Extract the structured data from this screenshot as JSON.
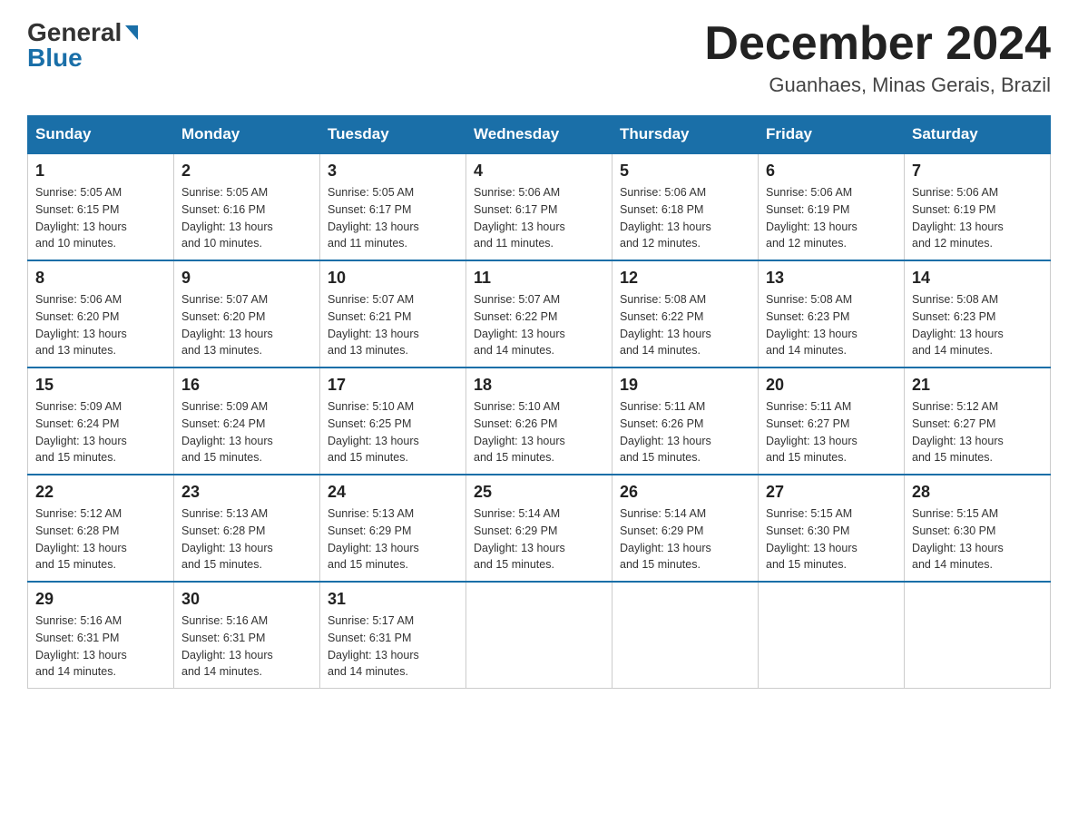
{
  "header": {
    "logo_general": "General",
    "logo_blue": "Blue",
    "month_title": "December 2024",
    "location": "Guanhaes, Minas Gerais, Brazil"
  },
  "days_of_week": [
    "Sunday",
    "Monday",
    "Tuesday",
    "Wednesday",
    "Thursday",
    "Friday",
    "Saturday"
  ],
  "weeks": [
    [
      {
        "day": "1",
        "sunrise": "5:05 AM",
        "sunset": "6:15 PM",
        "daylight": "13 hours and 10 minutes."
      },
      {
        "day": "2",
        "sunrise": "5:05 AM",
        "sunset": "6:16 PM",
        "daylight": "13 hours and 10 minutes."
      },
      {
        "day": "3",
        "sunrise": "5:05 AM",
        "sunset": "6:17 PM",
        "daylight": "13 hours and 11 minutes."
      },
      {
        "day": "4",
        "sunrise": "5:06 AM",
        "sunset": "6:17 PM",
        "daylight": "13 hours and 11 minutes."
      },
      {
        "day": "5",
        "sunrise": "5:06 AM",
        "sunset": "6:18 PM",
        "daylight": "13 hours and 12 minutes."
      },
      {
        "day": "6",
        "sunrise": "5:06 AM",
        "sunset": "6:19 PM",
        "daylight": "13 hours and 12 minutes."
      },
      {
        "day": "7",
        "sunrise": "5:06 AM",
        "sunset": "6:19 PM",
        "daylight": "13 hours and 12 minutes."
      }
    ],
    [
      {
        "day": "8",
        "sunrise": "5:06 AM",
        "sunset": "6:20 PM",
        "daylight": "13 hours and 13 minutes."
      },
      {
        "day": "9",
        "sunrise": "5:07 AM",
        "sunset": "6:20 PM",
        "daylight": "13 hours and 13 minutes."
      },
      {
        "day": "10",
        "sunrise": "5:07 AM",
        "sunset": "6:21 PM",
        "daylight": "13 hours and 13 minutes."
      },
      {
        "day": "11",
        "sunrise": "5:07 AM",
        "sunset": "6:22 PM",
        "daylight": "13 hours and 14 minutes."
      },
      {
        "day": "12",
        "sunrise": "5:08 AM",
        "sunset": "6:22 PM",
        "daylight": "13 hours and 14 minutes."
      },
      {
        "day": "13",
        "sunrise": "5:08 AM",
        "sunset": "6:23 PM",
        "daylight": "13 hours and 14 minutes."
      },
      {
        "day": "14",
        "sunrise": "5:08 AM",
        "sunset": "6:23 PM",
        "daylight": "13 hours and 14 minutes."
      }
    ],
    [
      {
        "day": "15",
        "sunrise": "5:09 AM",
        "sunset": "6:24 PM",
        "daylight": "13 hours and 15 minutes."
      },
      {
        "day": "16",
        "sunrise": "5:09 AM",
        "sunset": "6:24 PM",
        "daylight": "13 hours and 15 minutes."
      },
      {
        "day": "17",
        "sunrise": "5:10 AM",
        "sunset": "6:25 PM",
        "daylight": "13 hours and 15 minutes."
      },
      {
        "day": "18",
        "sunrise": "5:10 AM",
        "sunset": "6:26 PM",
        "daylight": "13 hours and 15 minutes."
      },
      {
        "day": "19",
        "sunrise": "5:11 AM",
        "sunset": "6:26 PM",
        "daylight": "13 hours and 15 minutes."
      },
      {
        "day": "20",
        "sunrise": "5:11 AM",
        "sunset": "6:27 PM",
        "daylight": "13 hours and 15 minutes."
      },
      {
        "day": "21",
        "sunrise": "5:12 AM",
        "sunset": "6:27 PM",
        "daylight": "13 hours and 15 minutes."
      }
    ],
    [
      {
        "day": "22",
        "sunrise": "5:12 AM",
        "sunset": "6:28 PM",
        "daylight": "13 hours and 15 minutes."
      },
      {
        "day": "23",
        "sunrise": "5:13 AM",
        "sunset": "6:28 PM",
        "daylight": "13 hours and 15 minutes."
      },
      {
        "day": "24",
        "sunrise": "5:13 AM",
        "sunset": "6:29 PM",
        "daylight": "13 hours and 15 minutes."
      },
      {
        "day": "25",
        "sunrise": "5:14 AM",
        "sunset": "6:29 PM",
        "daylight": "13 hours and 15 minutes."
      },
      {
        "day": "26",
        "sunrise": "5:14 AM",
        "sunset": "6:29 PM",
        "daylight": "13 hours and 15 minutes."
      },
      {
        "day": "27",
        "sunrise": "5:15 AM",
        "sunset": "6:30 PM",
        "daylight": "13 hours and 15 minutes."
      },
      {
        "day": "28",
        "sunrise": "5:15 AM",
        "sunset": "6:30 PM",
        "daylight": "13 hours and 14 minutes."
      }
    ],
    [
      {
        "day": "29",
        "sunrise": "5:16 AM",
        "sunset": "6:31 PM",
        "daylight": "13 hours and 14 minutes."
      },
      {
        "day": "30",
        "sunrise": "5:16 AM",
        "sunset": "6:31 PM",
        "daylight": "13 hours and 14 minutes."
      },
      {
        "day": "31",
        "sunrise": "5:17 AM",
        "sunset": "6:31 PM",
        "daylight": "13 hours and 14 minutes."
      },
      null,
      null,
      null,
      null
    ]
  ],
  "labels": {
    "sunrise": "Sunrise:",
    "sunset": "Sunset:",
    "daylight": "Daylight:"
  }
}
